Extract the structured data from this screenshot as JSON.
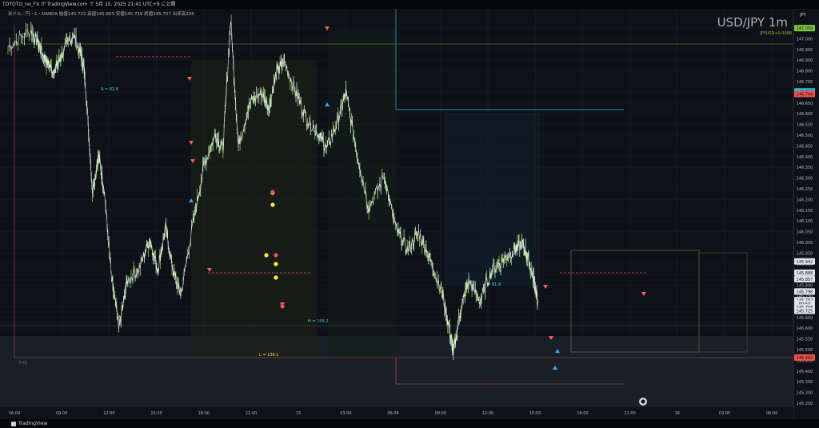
{
  "topbar": {
    "text": "TOTOTO_no_FX が TradingView.com で 5月 15, 2025 21:41 UTC+9 に公開"
  },
  "legend": {
    "text": "米ドル／円・1・OANDA 始値145.722 高値145.803 安値145.719 終値145.757 出来高226"
  },
  "watermark": {
    "symbol": "USD/JPY 1m"
  },
  "axis": {
    "currency": "JPY"
  },
  "annotations": {
    "a1": "A = 82.8",
    "a2": "A = 81.9",
    "l": "L = 138.1",
    "h": "H = 156.2",
    "fvg": "FVG"
  },
  "bottombar": {
    "brand": "TradingView"
  },
  "colors": {
    "background": "#0e1118",
    "up": "#c8e6c9",
    "down": "#ff5a5a",
    "accent_green": "#7ec63c",
    "accent_cyan": "#4dd0e1",
    "accent_red": "#ef5350"
  },
  "chart_data": {
    "type": "candlestick-line",
    "title": "USD/JPY 1m",
    "series_name": "JPYUSD+0.0068",
    "ylim": [
      145.25,
      147.15
    ],
    "yticks": [
      "147.100",
      "147.000",
      "146.950",
      "146.900",
      "146.800",
      "146.750",
      "146.700",
      "146.650",
      "146.600",
      "146.550",
      "146.500",
      "146.450",
      "146.400",
      "146.350",
      "146.300",
      "146.250",
      "146.200",
      "146.150",
      "146.100",
      "146.050",
      "146.000",
      "145.950",
      "145.900",
      "145.850",
      "145.800",
      "145.750",
      "145.700",
      "145.650",
      "145.600",
      "145.550",
      "145.500",
      "145.450",
      "145.400",
      "145.350",
      "145.300",
      "145.250"
    ],
    "xticks": [
      "06:04",
      "09:00",
      "12:00",
      "15:00",
      "18:00",
      "21:00",
      "15",
      "03:00",
      "06:04",
      "09:00",
      "12:00",
      "15:00",
      "18:00",
      "21:00",
      "16",
      "03:00",
      "06:00"
    ],
    "price_labels": [
      {
        "text": "147.059",
        "value": 147.059,
        "color": "#7ec63c"
      },
      {
        "text": "146.756",
        "value": 146.756,
        "color": "#26c6da"
      },
      {
        "text": "146.744",
        "value": 146.744,
        "color": "#ef5350"
      },
      {
        "text": "145.942",
        "value": 145.942,
        "color": "#e0e3eb"
      },
      {
        "text": "145.888",
        "value": 145.888,
        "color": "#e0e3eb"
      },
      {
        "text": "145.857",
        "value": 145.857,
        "color": "#e0e3eb"
      },
      {
        "text": "145.798",
        "value": 145.798,
        "color": "#8bc34a"
      },
      {
        "text": "145.798",
        "value": 145.798,
        "color": "#e0e3eb"
      },
      {
        "text": "145.757",
        "value": 145.757,
        "color": "#e0e3eb"
      },
      {
        "text": "00:53",
        "value": 145.74,
        "color": "#e0e3eb"
      },
      {
        "text": "145.756",
        "value": 145.722,
        "color": "#e0e3eb"
      },
      {
        "text": "145.725",
        "value": 145.705,
        "color": "#e0e3eb"
      },
      {
        "text": "145.482",
        "value": 145.482,
        "color": "#ef5350"
      }
    ],
    "price_path": [
      {
        "t": 0.0,
        "p": 146.97
      },
      {
        "t": 0.03,
        "p": 147.05
      },
      {
        "t": 0.04,
        "p": 146.98
      },
      {
        "t": 0.05,
        "p": 146.9
      },
      {
        "t": 0.06,
        "p": 146.85
      },
      {
        "t": 0.07,
        "p": 146.93
      },
      {
        "t": 0.085,
        "p": 147.03
      },
      {
        "t": 0.095,
        "p": 146.93
      },
      {
        "t": 0.1,
        "p": 146.84
      },
      {
        "t": 0.11,
        "p": 146.28
      },
      {
        "t": 0.118,
        "p": 146.45
      },
      {
        "t": 0.125,
        "p": 146.3
      },
      {
        "t": 0.135,
        "p": 145.85
      },
      {
        "t": 0.145,
        "p": 145.62
      },
      {
        "t": 0.155,
        "p": 145.85
      },
      {
        "t": 0.17,
        "p": 145.9
      },
      {
        "t": 0.185,
        "p": 146.05
      },
      {
        "t": 0.195,
        "p": 145.9
      },
      {
        "t": 0.205,
        "p": 146.1
      },
      {
        "t": 0.215,
        "p": 145.9
      },
      {
        "t": 0.225,
        "p": 145.78
      },
      {
        "t": 0.24,
        "p": 146.1
      },
      {
        "t": 0.255,
        "p": 146.4
      },
      {
        "t": 0.27,
        "p": 146.55
      },
      {
        "t": 0.28,
        "p": 146.48
      },
      {
        "t": 0.29,
        "p": 147.1
      },
      {
        "t": 0.3,
        "p": 146.5
      },
      {
        "t": 0.315,
        "p": 146.7
      },
      {
        "t": 0.33,
        "p": 146.75
      },
      {
        "t": 0.34,
        "p": 146.68
      },
      {
        "t": 0.35,
        "p": 146.85
      },
      {
        "t": 0.36,
        "p": 146.9
      },
      {
        "t": 0.375,
        "p": 146.75
      },
      {
        "t": 0.39,
        "p": 146.62
      },
      {
        "t": 0.405,
        "p": 146.55
      },
      {
        "t": 0.415,
        "p": 146.48
      },
      {
        "t": 0.43,
        "p": 146.62
      },
      {
        "t": 0.44,
        "p": 146.75
      },
      {
        "t": 0.455,
        "p": 146.45
      },
      {
        "t": 0.47,
        "p": 146.2
      },
      {
        "t": 0.49,
        "p": 146.35
      },
      {
        "t": 0.505,
        "p": 146.1
      },
      {
        "t": 0.52,
        "p": 146.0
      },
      {
        "t": 0.535,
        "p": 146.08
      },
      {
        "t": 0.55,
        "p": 145.95
      },
      {
        "t": 0.565,
        "p": 145.8
      },
      {
        "t": 0.575,
        "p": 145.62
      },
      {
        "t": 0.58,
        "p": 145.5
      },
      {
        "t": 0.59,
        "p": 145.72
      },
      {
        "t": 0.6,
        "p": 145.85
      },
      {
        "t": 0.615,
        "p": 145.75
      },
      {
        "t": 0.63,
        "p": 145.9
      },
      {
        "t": 0.645,
        "p": 145.95
      },
      {
        "t": 0.66,
        "p": 146.0
      },
      {
        "t": 0.67,
        "p": 146.03
      },
      {
        "t": 0.678,
        "p": 145.95
      },
      {
        "t": 0.685,
        "p": 145.85
      },
      {
        "t": 0.69,
        "p": 145.75
      }
    ]
  }
}
